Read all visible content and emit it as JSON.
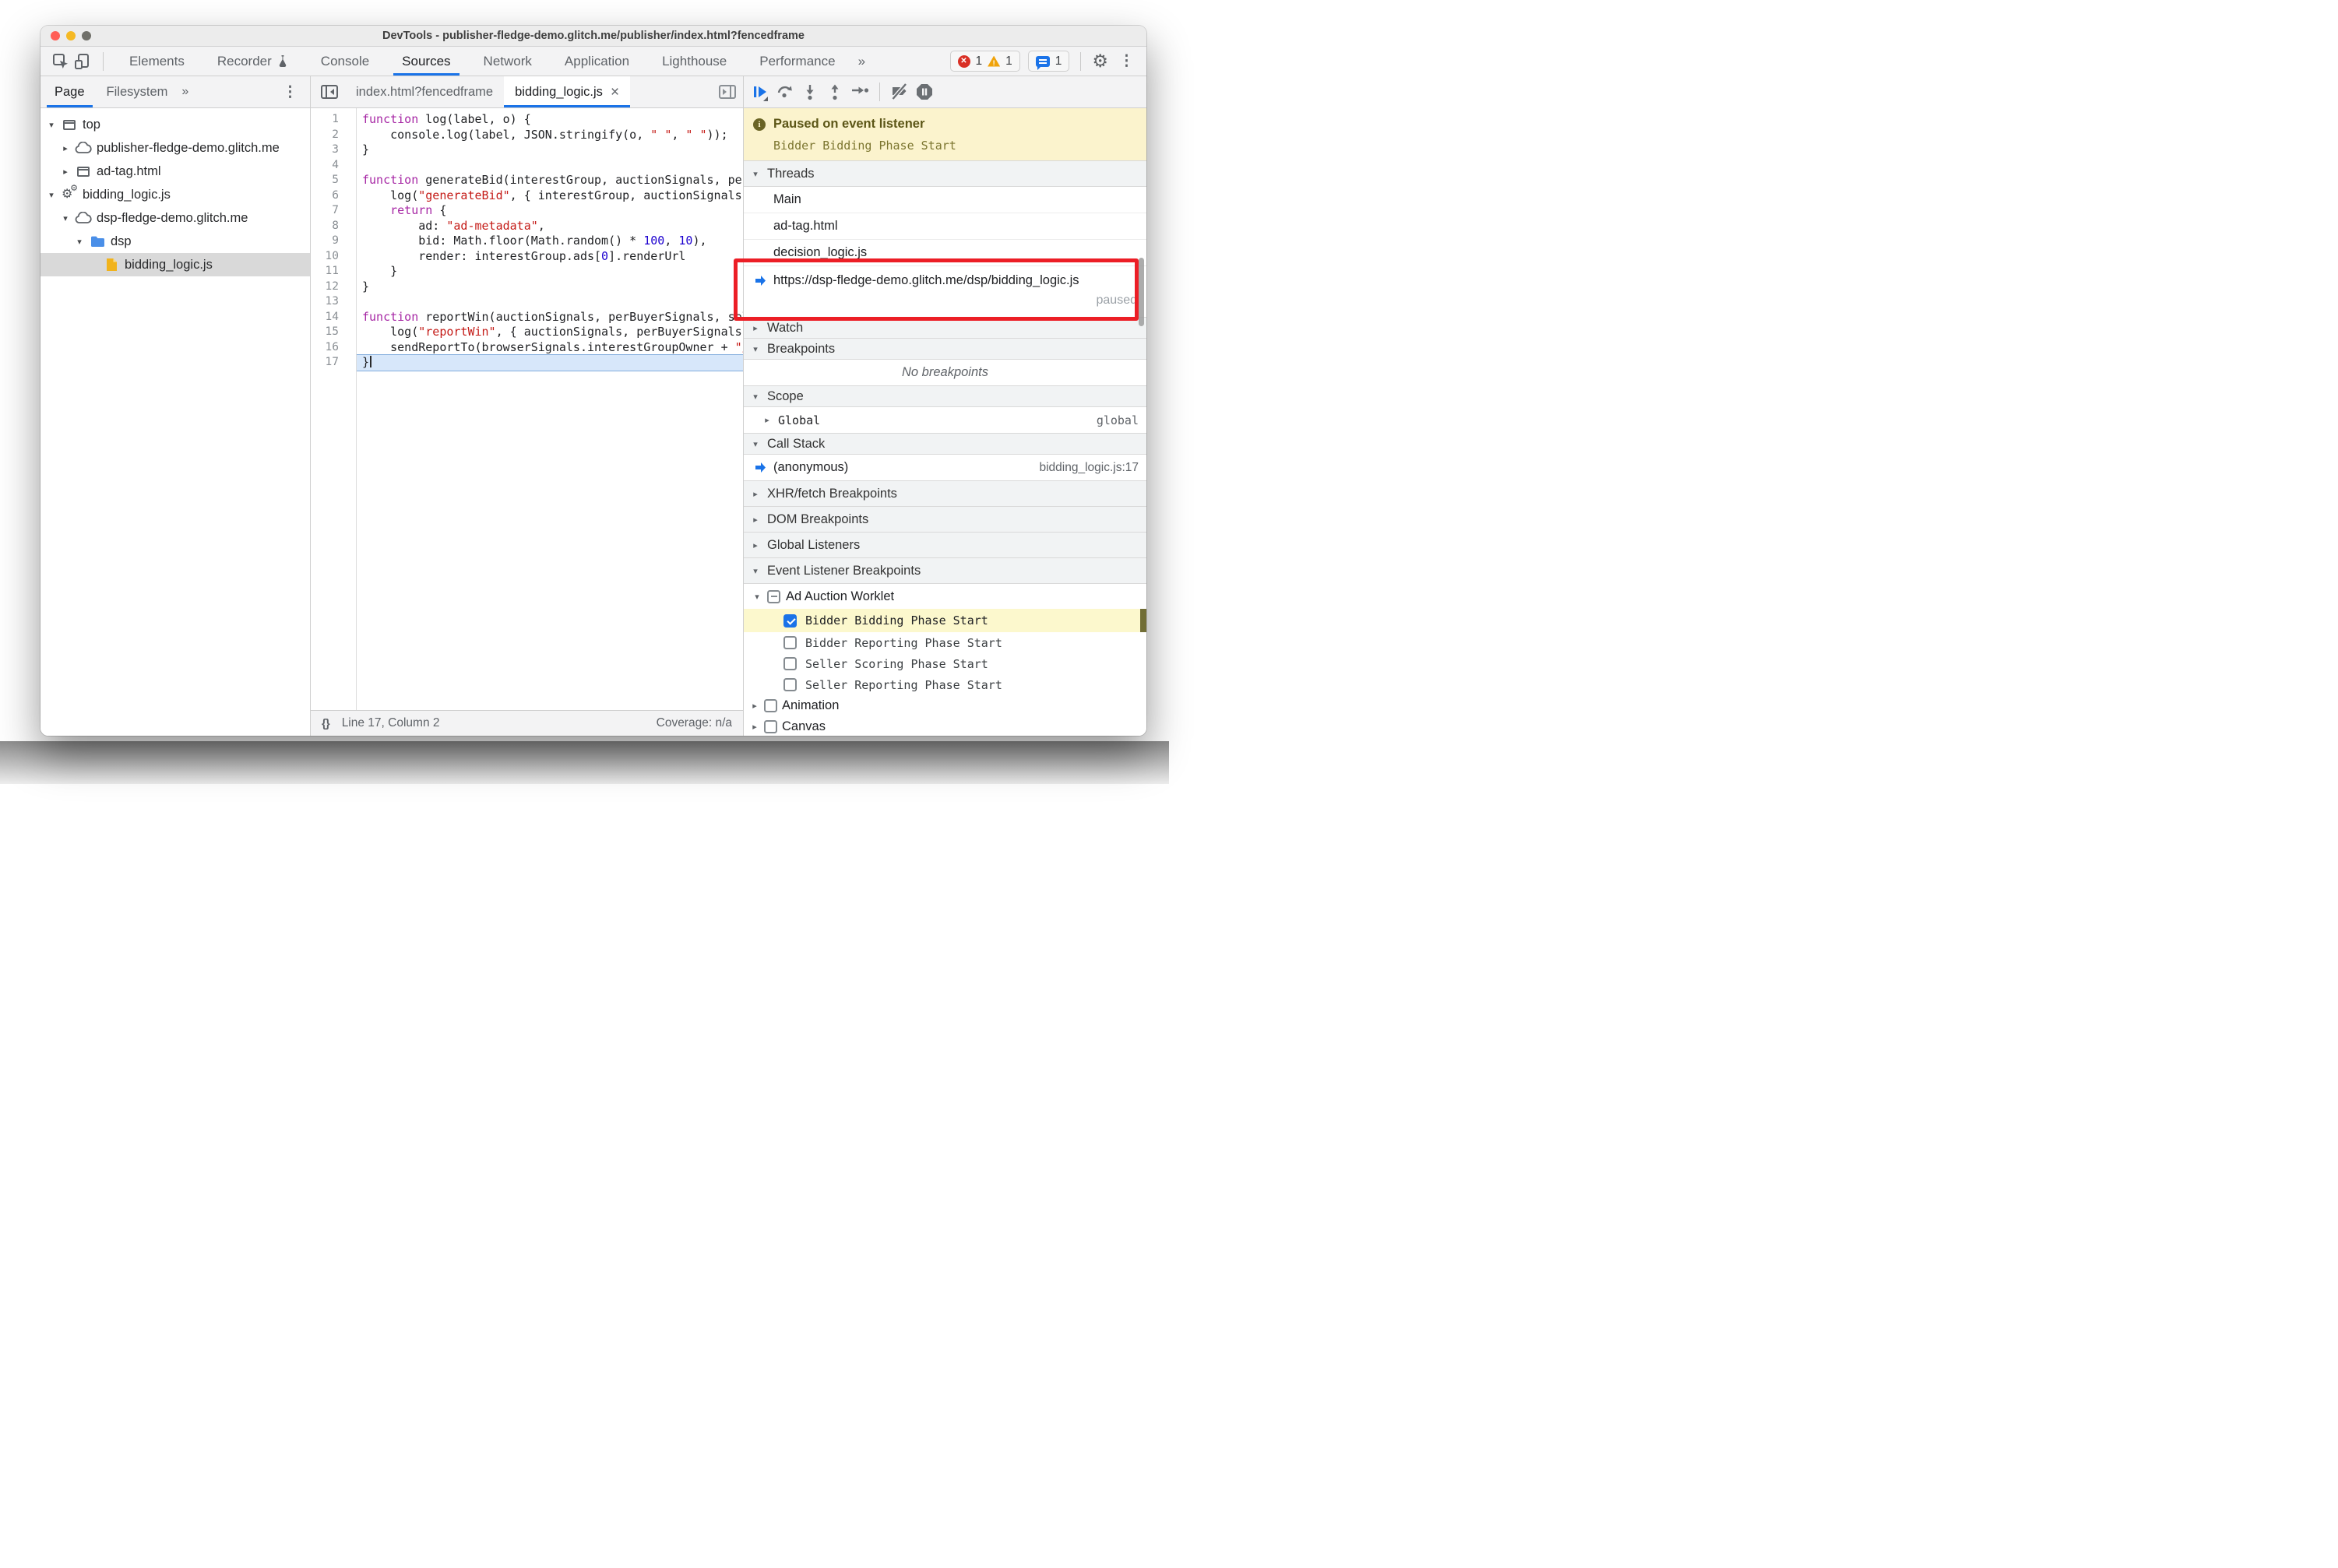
{
  "window_title": "DevTools - publisher-fledge-demo.glitch.me/publisher/index.html?fencedframe",
  "icons": {
    "chevron_double": "»",
    "kebab": "⋮",
    "gear": "⚙",
    "close": "×",
    "expanded": "▾",
    "collapsed": "▸",
    "tree_expanded": "▾",
    "tree_collapsed": "▸",
    "braces": "{}",
    "gear_glyph_big": "⚙",
    "gear_glyph_small": "⚙",
    "info": "i",
    "error_x": "✕",
    "warning_mark": "!"
  },
  "main_toolbar": {
    "tabs": [
      "Elements",
      "Recorder",
      "Console",
      "Sources",
      "Network",
      "Application",
      "Lighthouse",
      "Performance"
    ],
    "active_tab": "Sources",
    "error_count": "1",
    "warning_count": "1",
    "issue_count": "1"
  },
  "sidebar": {
    "tabs": [
      "Page",
      "Filesystem"
    ],
    "active_tab": "Page",
    "tree": [
      {
        "label": "top",
        "expander": "▾"
      },
      {
        "label": "publisher-fledge-demo.glitch.me",
        "expander": "▸"
      },
      {
        "label": "ad-tag.html",
        "expander": "▸"
      },
      {
        "label": "bidding_logic.js",
        "expander": "▾"
      },
      {
        "label": "dsp-fledge-demo.glitch.me",
        "expander": "▾"
      },
      {
        "label": "dsp",
        "expander": "▾"
      },
      {
        "label": "bidding_logic.js",
        "expander": "",
        "selected": true
      }
    ]
  },
  "editor": {
    "tabs": [
      "index.html?fencedframe",
      "bidding_logic.js"
    ],
    "active_tab": "bidding_logic.js",
    "lines": [
      {
        "n": "1",
        "code": "function log(label, o) {"
      },
      {
        "n": "2",
        "code": "    console.log(label, JSON.stringify(o, \" \", \" \"));"
      },
      {
        "n": "3",
        "code": "}"
      },
      {
        "n": "4",
        "code": ""
      },
      {
        "n": "5",
        "code": "function generateBid(interestGroup, auctionSignals, perBuyerSignals, trustedBiddingSignals, browserSignals) {"
      },
      {
        "n": "6",
        "code": "    log(\"generateBid\", { interestGroup, auctionSignals, perBuyerSignals, trustedBiddingSignals, browserSignals });"
      },
      {
        "n": "7",
        "code": "    return {"
      },
      {
        "n": "8",
        "code": "        ad: \"ad-metadata\","
      },
      {
        "n": "9",
        "code": "        bid: Math.floor(Math.random() * 100, 10),"
      },
      {
        "n": "10",
        "code": "        render: interestGroup.ads[0].renderUrl"
      },
      {
        "n": "11",
        "code": "    }"
      },
      {
        "n": "12",
        "code": "}"
      },
      {
        "n": "13",
        "code": ""
      },
      {
        "n": "14",
        "code": "function reportWin(auctionSignals, perBuyerSignals, sellerSignals, browserSignals) {"
      },
      {
        "n": "15",
        "code": "    log(\"reportWin\", { auctionSignals, perBuyerSignals, sellerSignals, browserSignals });"
      },
      {
        "n": "16",
        "code": "    sendReportTo(browserSignals.interestGroupOwner + \"/report?result=win\");"
      },
      {
        "n": "17",
        "code": "}"
      }
    ],
    "status": {
      "line_col": "Line 17, Column 2",
      "coverage": "Coverage: n/a"
    }
  },
  "debugger": {
    "paused": {
      "title": "Paused on event listener",
      "detail": "Bidder Bidding Phase Start"
    },
    "threads": {
      "label": "Threads",
      "items": [
        "Main",
        "ad-tag.html",
        "decision_logic.js"
      ],
      "paused_thread": {
        "url": "https://dsp-fledge-demo.glitch.me/dsp/bidding_logic.js",
        "state": "paused"
      }
    },
    "watch_label": "Watch",
    "breakpoints": {
      "label": "Breakpoints",
      "empty": "No breakpoints"
    },
    "scope": {
      "label": "Scope",
      "name": "Global",
      "value": "global"
    },
    "call_stack": {
      "label": "Call Stack",
      "frame": "(anonymous)",
      "location": "bidding_logic.js:17"
    },
    "xhr_label": "XHR/fetch Breakpoints",
    "dom_label": "DOM Breakpoints",
    "global_listeners_label": "Global Listeners",
    "event_listener_breakpoints_label": "Event Listener Breakpoints",
    "worklet": {
      "label": "Ad Auction Worklet",
      "events": [
        {
          "label": "Bidder Bidding Phase Start",
          "checked": true,
          "highlighted": true
        },
        {
          "label": "Bidder Reporting Phase Start",
          "checked": false
        },
        {
          "label": "Seller Scoring Phase Start",
          "checked": false
        },
        {
          "label": "Seller Reporting Phase Start",
          "checked": false
        }
      ]
    },
    "animation_label": "Animation",
    "canvas_label": "Canvas"
  },
  "colors": {
    "accent_blue": "#1a73e8",
    "error_red": "#d93025",
    "warning_yellow": "#f0a30a",
    "annotation_red": "#ec1e26",
    "paused_banner_bg": "#fbf3cd",
    "highlight_row_bg": "#fcf8cd",
    "current_line_bg": "#d7e7fa"
  }
}
